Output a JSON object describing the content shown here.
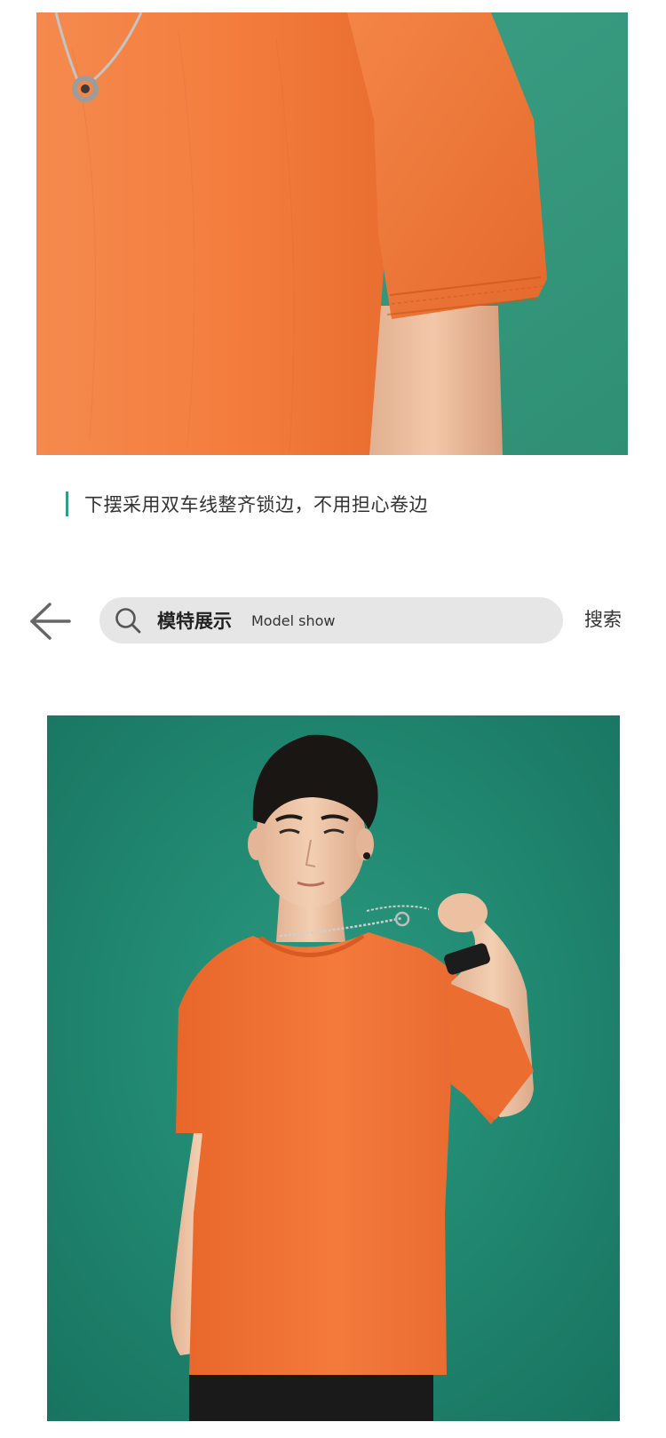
{
  "caption": {
    "text": "下摆采用双车线整齐锁边，不用担心卷边",
    "accent_color": "#2f9f84"
  },
  "search": {
    "back_icon": "arrow-left-icon",
    "icon": "search-icon",
    "title": "模特展示",
    "subtitle": "Model show",
    "button_label": "搜索"
  },
  "photos": {
    "top": {
      "subject": "orange-tshirt-sleeve-hem-closeup",
      "background_color": "#3a9a80",
      "shirt_color": "#f07a3c"
    },
    "model": {
      "subject": "model-wearing-orange-tshirt",
      "background_color": "#1e8a73",
      "shirt_color": "#ee6f2f"
    }
  }
}
